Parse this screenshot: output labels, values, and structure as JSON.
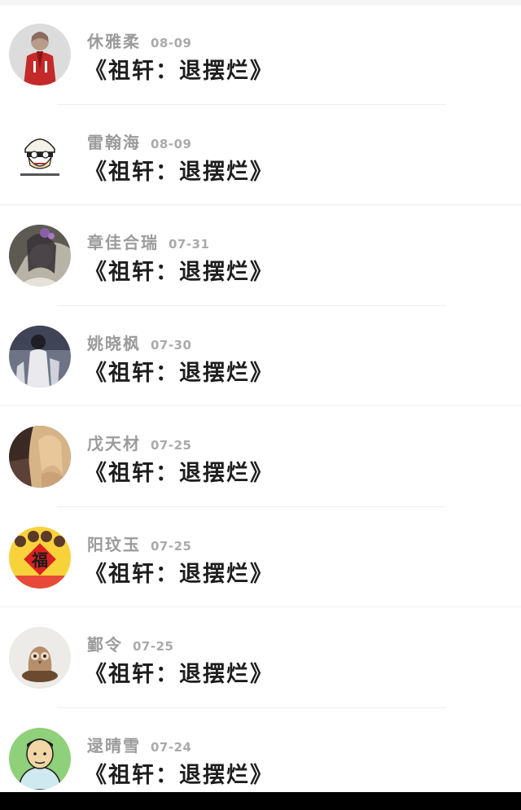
{
  "comments": [
    {
      "name": "休雅柔",
      "date": "08-09",
      "text": "《祖轩：退摆烂》",
      "avatar": "avatar-red-coat"
    },
    {
      "name": "雷翰海",
      "date": "08-09",
      "text": "《祖轩：退摆烂》",
      "avatar": "avatar-cartoon-sticker"
    },
    {
      "name": "章佳合瑞",
      "date": "07-31",
      "text": "《祖轩：退摆烂》",
      "avatar": "avatar-girl-flowers"
    },
    {
      "name": "姚晓枫",
      "date": "07-30",
      "text": "《祖轩：退摆烂》",
      "avatar": "avatar-dark-figure"
    },
    {
      "name": "戊天材",
      "date": "07-25",
      "text": "《祖轩：退摆烂》",
      "avatar": "avatar-blonde-girl"
    },
    {
      "name": "阳玟玉",
      "date": "07-25",
      "text": "《祖轩：退摆烂》",
      "avatar": "avatar-fu-red"
    },
    {
      "name": "鄞令",
      "date": "07-25",
      "text": "《祖轩：退摆烂》",
      "avatar": "avatar-wood-owl"
    },
    {
      "name": "逯晴雪",
      "date": "07-24",
      "text": "《祖轩：退摆烂》",
      "avatar": "avatar-cartoon-man"
    }
  ]
}
